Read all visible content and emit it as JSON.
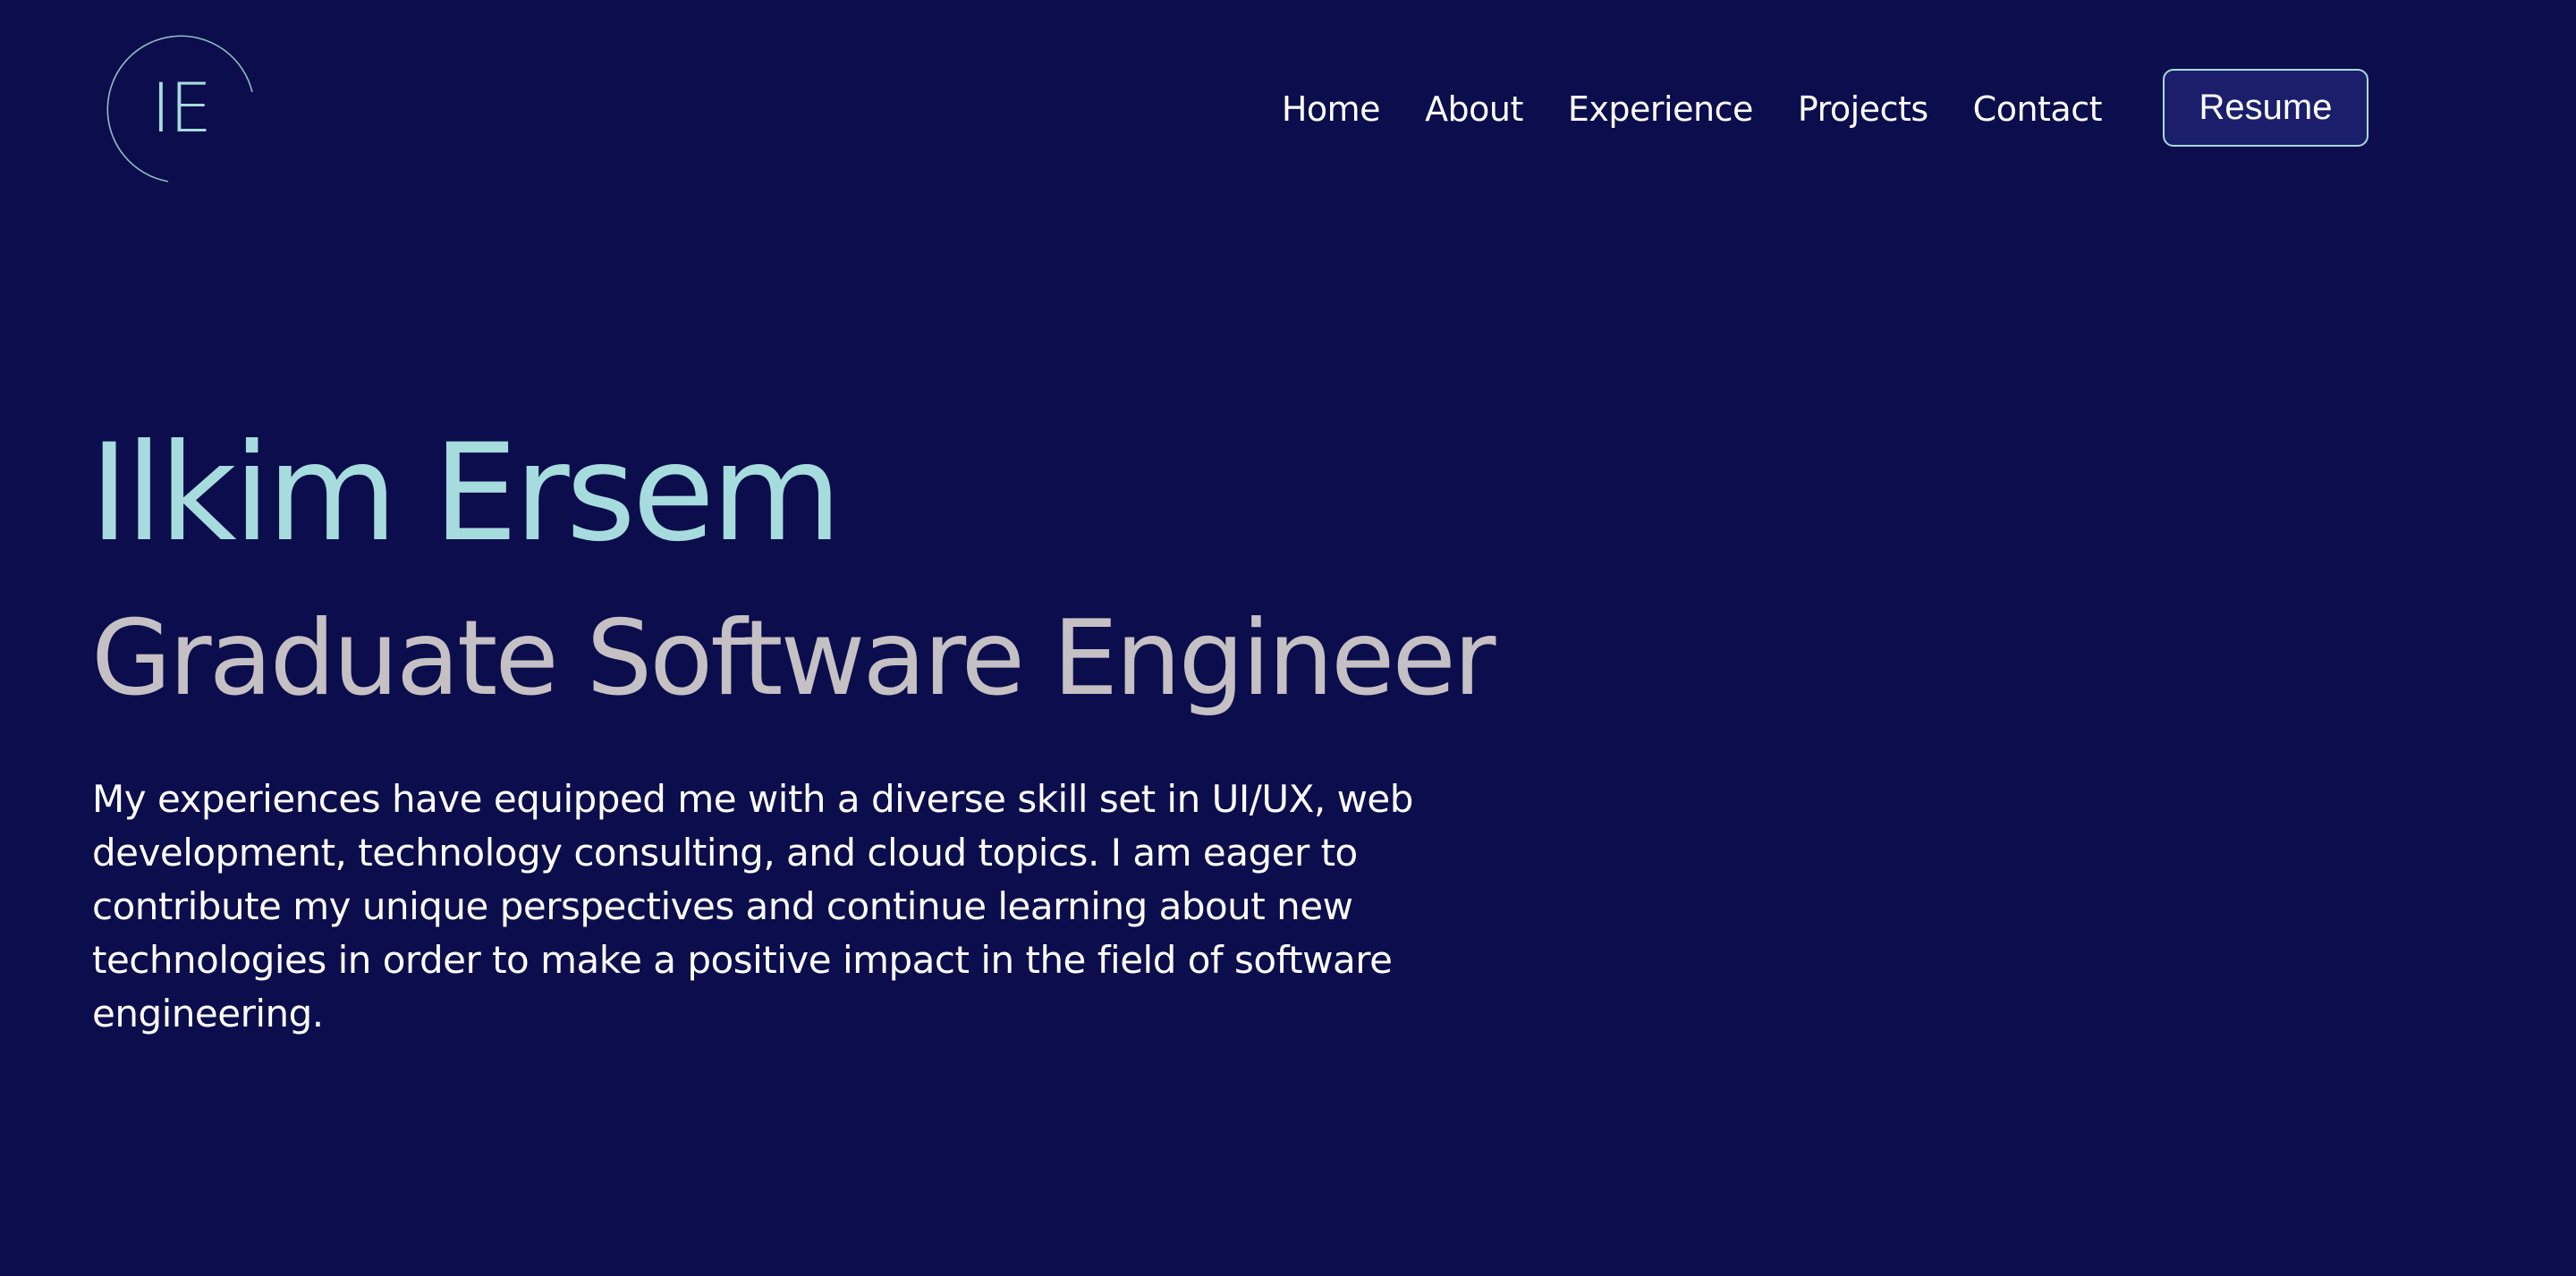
{
  "brand": {
    "logo_text": "IE"
  },
  "nav": {
    "items": [
      {
        "label": "Home"
      },
      {
        "label": "About"
      },
      {
        "label": "Experience"
      },
      {
        "label": "Projects"
      },
      {
        "label": "Contact"
      }
    ],
    "resume_label": "Resume"
  },
  "hero": {
    "name": "Ilkim Ersem",
    "role": "Graduate Software Engineer",
    "bio": "My experiences have equipped me with a diverse skill set in UI/UX, web development, technology consulting, and cloud topics. I am eager to contribute my unique perspectives and continue learning about new technologies in order to make a positive impact in the field of software engineering."
  },
  "colors": {
    "background": "#0b0d4c",
    "accent": "#a6dcdd",
    "subtitle": "#c4c0c4",
    "button_bg": "#1b1f6b",
    "text": "#ffffff"
  }
}
